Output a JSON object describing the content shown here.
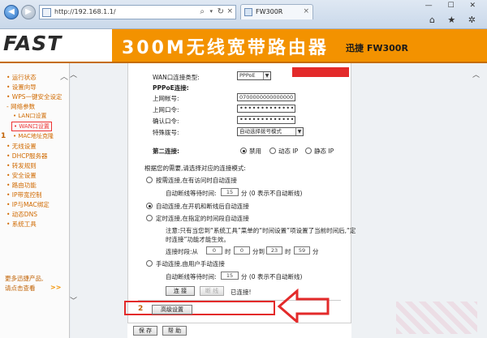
{
  "browser": {
    "url": "http://192.168.1.1/",
    "tab_title": "FW300R",
    "search_icon": "search-icon",
    "dropdown_glyph": "▾",
    "refresh_glyph": "↻",
    "close_glyph": "×",
    "win_controls": "— ☐ ✕",
    "tools_icons": "⌂ ★ ✲"
  },
  "header": {
    "logo": "FAST",
    "product_title": "300M无线宽带路由器",
    "model": "迅捷 FW300R",
    "color": "#f39200"
  },
  "sidebar": {
    "items": [
      {
        "label": "• 运行状态"
      },
      {
        "label": "• 设置向导"
      },
      {
        "label": "• WPS一键安全设定"
      },
      {
        "label": "- 网络参数"
      },
      {
        "label": "• LAN口设置"
      },
      {
        "label": "• WAN口设置"
      },
      {
        "label": "• MAC地址克隆"
      },
      {
        "label": "• 无线设置"
      },
      {
        "label": "• DHCP服务器"
      },
      {
        "label": "• 转发规则"
      },
      {
        "label": "• 安全设置"
      },
      {
        "label": "• 路由功能"
      },
      {
        "label": "• IP带宽控制"
      },
      {
        "label": "• IP与MAC绑定"
      },
      {
        "label": "• 动态DNS"
      },
      {
        "label": "• 系统工具"
      }
    ],
    "promo_line1": "更多迅捷产品,",
    "promo_line2": "请点击查看",
    "promo_arrows": ">>",
    "step_one": "1"
  },
  "form": {
    "wan_type_label": "WAN口连接类型:",
    "wan_type_value": "PPPoE",
    "pppoe_section": "PPPoE连接:",
    "account_label": "上网帐号:",
    "account_value": "0700000000000000",
    "password_label": "上网口令:",
    "password_value": "•••••••••••••••",
    "confirm_label": "确认口令:",
    "confirm_value": "•••••••••••••••",
    "dial_mode_label": "特殊拨号:",
    "dial_mode_value": "自动选择拨号模式",
    "second_conn_label": "第二连接:",
    "second_conn_options": [
      "禁用",
      "动态 IP",
      "静态 IP"
    ],
    "mode_prompt": "根据您的需要,请选择对应的连接模式:",
    "on_demand_label": "按需连接,在有访问时自动连接",
    "on_demand_idle_label": "自动断线等待时间:",
    "on_demand_idle_value": "15",
    "on_demand_idle_unit": "分 (0 表示不自动断线)",
    "auto_label": "自动连接,在开机和断线后自动连接",
    "timed_label": "定时连接,在指定的时间段自动连接",
    "timed_note_line1": "注意:只有当您到“系统工具”菜单的“时间设置”项设置了当前时间后,“定",
    "timed_note_line2": "时连接”功能才能生效。",
    "timed_period_label": "连接时段:从",
    "timed_from_h": "0",
    "timed_h_unit": "时",
    "timed_from_m": "0",
    "timed_to_label": "分到",
    "timed_to_h": "23",
    "timed_to_m": "59",
    "timed_m_unit": "分",
    "manual_label": "手动连接,由用户手动连接",
    "manual_idle_label": "自动断线等待时间:",
    "manual_idle_value": "15",
    "manual_idle_unit": "分 (0 表示不自动断线)",
    "connect_btn": "连 接",
    "disconnect_btn": "断 线",
    "status_text": "已连接!",
    "advanced_btn": "高级设置",
    "step_two": "2",
    "save_btn": "保 存",
    "help_btn": "帮 助"
  },
  "annotations": {
    "highlight_color": "#e32a2a"
  }
}
